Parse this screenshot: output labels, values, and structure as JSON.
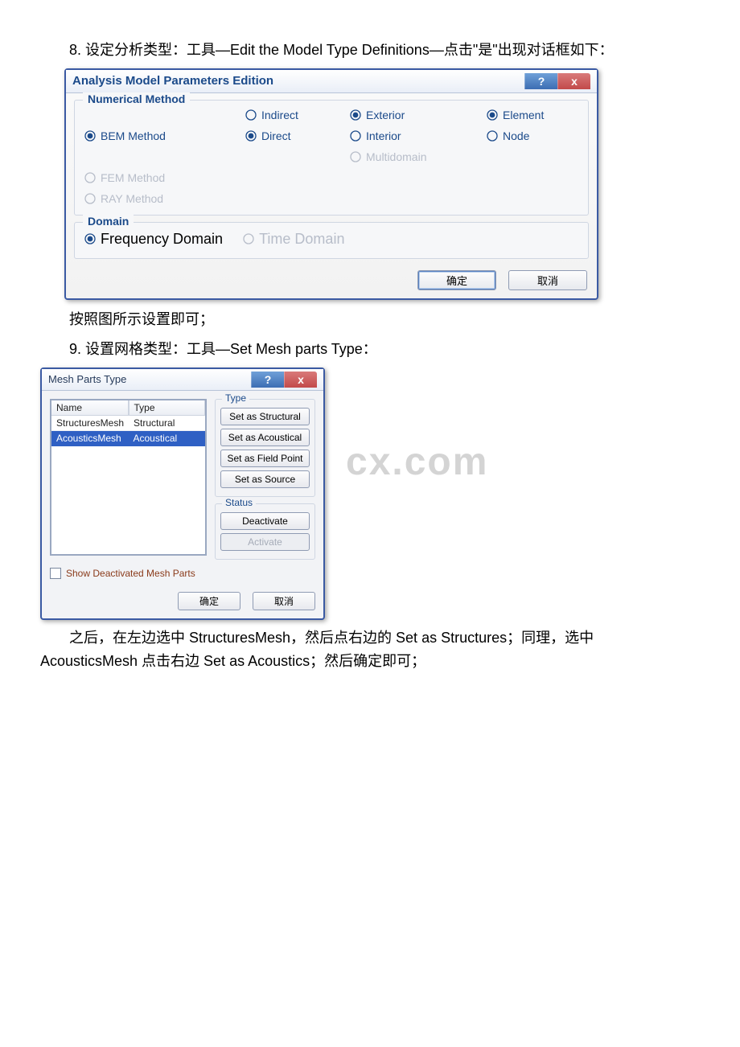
{
  "step8_text": "8. 设定分析类型：工具—Edit the Model Type Definitions—点击\"是\"出现对话框如下：",
  "between_text": "按照图所示设置即可；",
  "step9_text": "9. 设置网格类型：工具—Set Mesh parts Type：",
  "closing_text": "之后，在左边选中 StructuresMesh，然后点右边的 Set as Structures；同理，选中 AcousticsMesh 点击右边 Set as Acoustics；然后确定即可；",
  "watermark": "cx.com",
  "dialog1": {
    "title": "Analysis Model Parameters Edition",
    "group_method_legend": "Numerical Method",
    "group_domain_legend": "Domain",
    "options": {
      "bem": "BEM Method",
      "fem": "FEM Method",
      "ray": "RAY Method",
      "indirect": "Indirect",
      "direct": "Direct",
      "exterior": "Exterior",
      "interior": "Interior",
      "multidomain": "Multidomain",
      "element": "Element",
      "node": "Node",
      "freq": "Frequency Domain",
      "time": "Time Domain"
    },
    "buttons": {
      "ok": "确定",
      "cancel": "取消"
    },
    "help_glyph": "?",
    "close_glyph": "x"
  },
  "dialog2": {
    "title": "Mesh Parts Type",
    "help_glyph": "?",
    "close_glyph": "x",
    "headers": {
      "name": "Name",
      "type": "Type"
    },
    "rows": [
      {
        "name": "StructuresMesh",
        "type": "Structural"
      },
      {
        "name": "AcousticsMesh",
        "type": "Acoustical"
      }
    ],
    "type_group": {
      "legend": "Type",
      "set_structural": "Set as Structural",
      "set_acoustical": "Set as Acoustical",
      "set_fieldpoint": "Set as Field Point",
      "set_source": "Set as Source"
    },
    "status_group": {
      "legend": "Status",
      "deactivate": "Deactivate",
      "activate": "Activate"
    },
    "checkbox_label": "Show Deactivated Mesh Parts",
    "buttons": {
      "ok": "确定",
      "cancel": "取消"
    }
  }
}
